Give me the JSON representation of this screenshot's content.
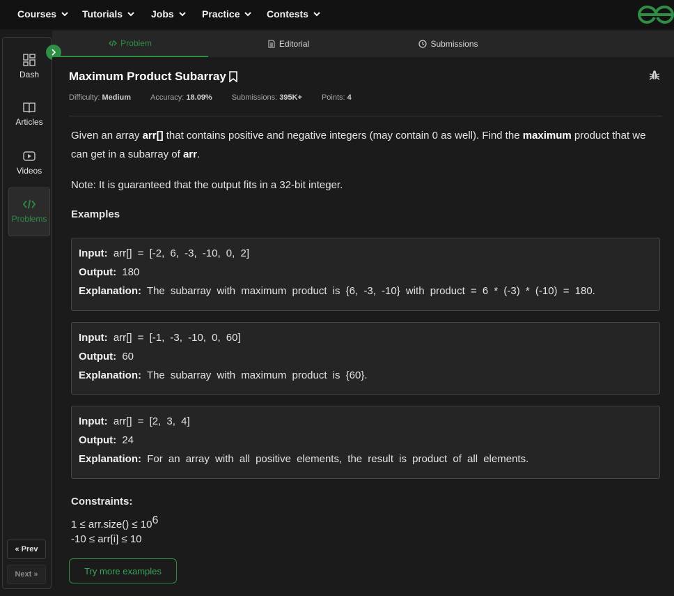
{
  "topnav": {
    "items": [
      {
        "label": "Courses"
      },
      {
        "label": "Tutorials"
      },
      {
        "label": "Jobs"
      },
      {
        "label": "Practice"
      },
      {
        "label": "Contests"
      }
    ]
  },
  "sidebar": {
    "items": [
      {
        "label": "Dash",
        "icon": "dashboard-icon"
      },
      {
        "label": "Articles",
        "icon": "book-icon"
      },
      {
        "label": "Videos",
        "icon": "video-icon"
      },
      {
        "label": "Problems",
        "icon": "code-icon",
        "active": true
      }
    ],
    "prev_label": "Prev",
    "next_label": "Next"
  },
  "tabs": [
    {
      "label": "Problem",
      "icon": "code-icon",
      "active": true
    },
    {
      "label": "Editorial",
      "icon": "document-icon"
    },
    {
      "label": "Submissions",
      "icon": "clock-icon"
    }
  ],
  "problem": {
    "title": "Maximum Product Subarray",
    "meta": {
      "difficulty_label": "Difficulty:",
      "difficulty": "Medium",
      "accuracy_label": "Accuracy:",
      "accuracy": "18.09%",
      "submissions_label": "Submissions:",
      "submissions": "395K+",
      "points_label": "Points:",
      "points": "4"
    },
    "desc_1": "Given an array",
    "desc_arr": "arr[]",
    "desc_2": "that contains positive and negative integers (may contain 0 as well). Find the",
    "desc_max": "maximum",
    "desc_3": "product that we can get in a subarray of",
    "desc_arr2": "arr",
    "desc_end": ".",
    "note": "Note: It is guaranteed that the output fits in a 32-bit integer.",
    "examples_heading": "Examples",
    "examples": [
      {
        "input": "arr[] = [-2, 6, -3, -10, 0, 2]",
        "output": "180",
        "explanation": "The subarray with maximum product is {6, -3, -10} with product = 6 * (-3) * (-10) = 180."
      },
      {
        "input": "arr[] = [-1, -3, -10, 0, 60]",
        "output": "60",
        "explanation": "The subarray with maximum product is {60}."
      },
      {
        "input": "arr[] = [2, 3, 4]",
        "output": "24",
        "explanation": "For an array with all positive elements, the result is product of all elements."
      }
    ],
    "labels": {
      "input": "Input:",
      "output": "Output:",
      "explanation": "Explanation:"
    },
    "constraints_heading": "Constraints:",
    "constraint_1": "1 ≤ arr.size() ≤ 10",
    "constraint_1_exp": "6",
    "constraint_2": "-10  ≤  arr[i]  ≤  10",
    "try_button": "Try more examples"
  },
  "colors": {
    "accent": "#2f8d46",
    "background": "#1b1b1b",
    "topbar": "#121212"
  }
}
